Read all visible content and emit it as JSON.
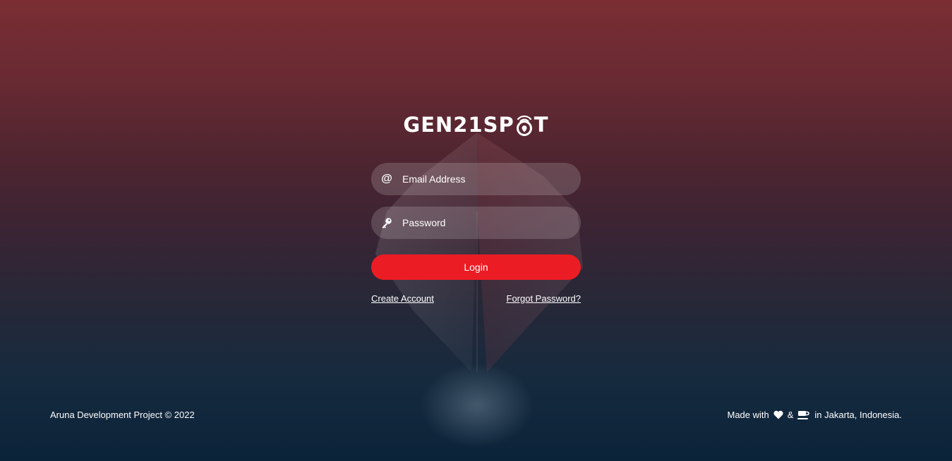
{
  "brand": {
    "name_part1": "GEN21SP",
    "name_part2": "T",
    "logo_icon": "location-pin-wifi-icon"
  },
  "login_form": {
    "email": {
      "placeholder": "Email Address",
      "value": "",
      "icon": "at-icon"
    },
    "password": {
      "placeholder": "Password",
      "value": "",
      "icon": "key-icon"
    },
    "login_label": "Login",
    "create_account_label": "Create Account",
    "forgot_password_label": "Forgot Password?"
  },
  "footer": {
    "copyright": "Aruna Development Project © 2022",
    "made_with": "Made with",
    "ampersand": "&",
    "location": "in Jakarta, Indonesia.",
    "icons": [
      "heart-icon",
      "coffee-icon"
    ]
  },
  "colors": {
    "accent": "#ec1c24",
    "bg_top": "#7a2e33",
    "bg_bottom": "#0b2339",
    "field_bg": "rgba(255,255,255,0.16)"
  }
}
